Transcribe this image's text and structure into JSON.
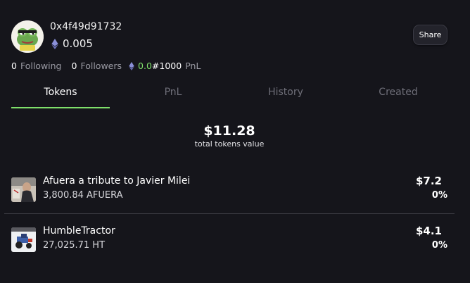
{
  "profile": {
    "address": "0x4f49d91732",
    "balance": "0.005",
    "avatar_icon": "pepe-frog-avatar-icon",
    "share_label": "Share"
  },
  "stats": {
    "following_count": "0",
    "following_label": "Following",
    "followers_count": "0",
    "followers_label": "Followers",
    "pnl_value": "0.0",
    "rank": "#1000",
    "pnl_label": "PnL"
  },
  "tabs": [
    {
      "label": "Tokens",
      "active": true
    },
    {
      "label": "PnL",
      "active": false
    },
    {
      "label": "History",
      "active": false
    },
    {
      "label": "Created",
      "active": false
    }
  ],
  "summary": {
    "total_value": "$11.28",
    "total_label": "total tokens value"
  },
  "tokens": [
    {
      "name": "Afuera a tribute to Javier Milei",
      "amount": "3,800.84 AFUERA",
      "value": "$7.2",
      "change": "0%"
    },
    {
      "name": "HumbleTractor",
      "amount": "27,025.71 HT",
      "value": "$4.1",
      "change": "0%"
    }
  ],
  "colors": {
    "background": "#15151b",
    "accent_green": "#7ee06a",
    "muted_text": "#9a9aa3",
    "ethereum": "#8a8fd8"
  }
}
